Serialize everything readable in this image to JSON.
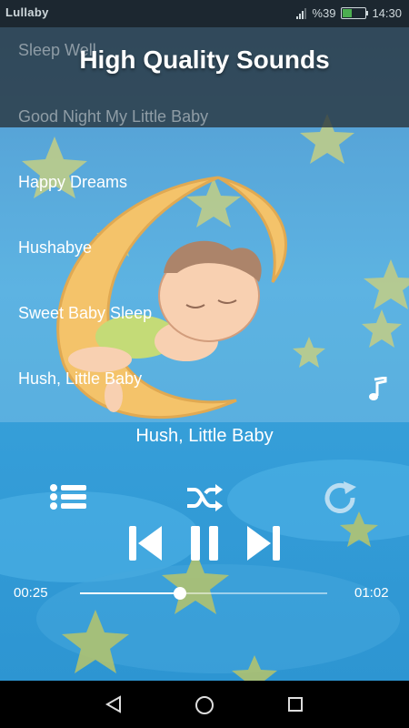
{
  "status_bar": {
    "app_name": "Lullaby",
    "battery": "%39",
    "time": "14:30",
    "battery_level": 0.39
  },
  "promo": {
    "title": "High Quality Sounds"
  },
  "playlist": {
    "items": [
      {
        "label": "Sleep Well"
      },
      {
        "label": "Good Night My Little Baby"
      },
      {
        "label": "Happy Dreams"
      },
      {
        "label": "Hushabye"
      },
      {
        "label": "Sweet Baby Sleep"
      },
      {
        "label": "Hush, Little Baby"
      }
    ]
  },
  "player": {
    "now_playing": "Hush, Little Baby",
    "elapsed": "00:25",
    "duration": "01:02",
    "progress": 0.403
  },
  "colors": {
    "accent": "#ffffff",
    "sky": "#2e86c8",
    "moon": "#f2b64a",
    "star": "#b7c46a"
  },
  "icons": {
    "music_note": "music-note-icon",
    "playlist": "list-icon",
    "shuffle": "shuffle-icon",
    "repeat": "repeat-icon",
    "prev": "skip-previous-icon",
    "pause": "pause-icon",
    "next": "skip-next-icon"
  }
}
